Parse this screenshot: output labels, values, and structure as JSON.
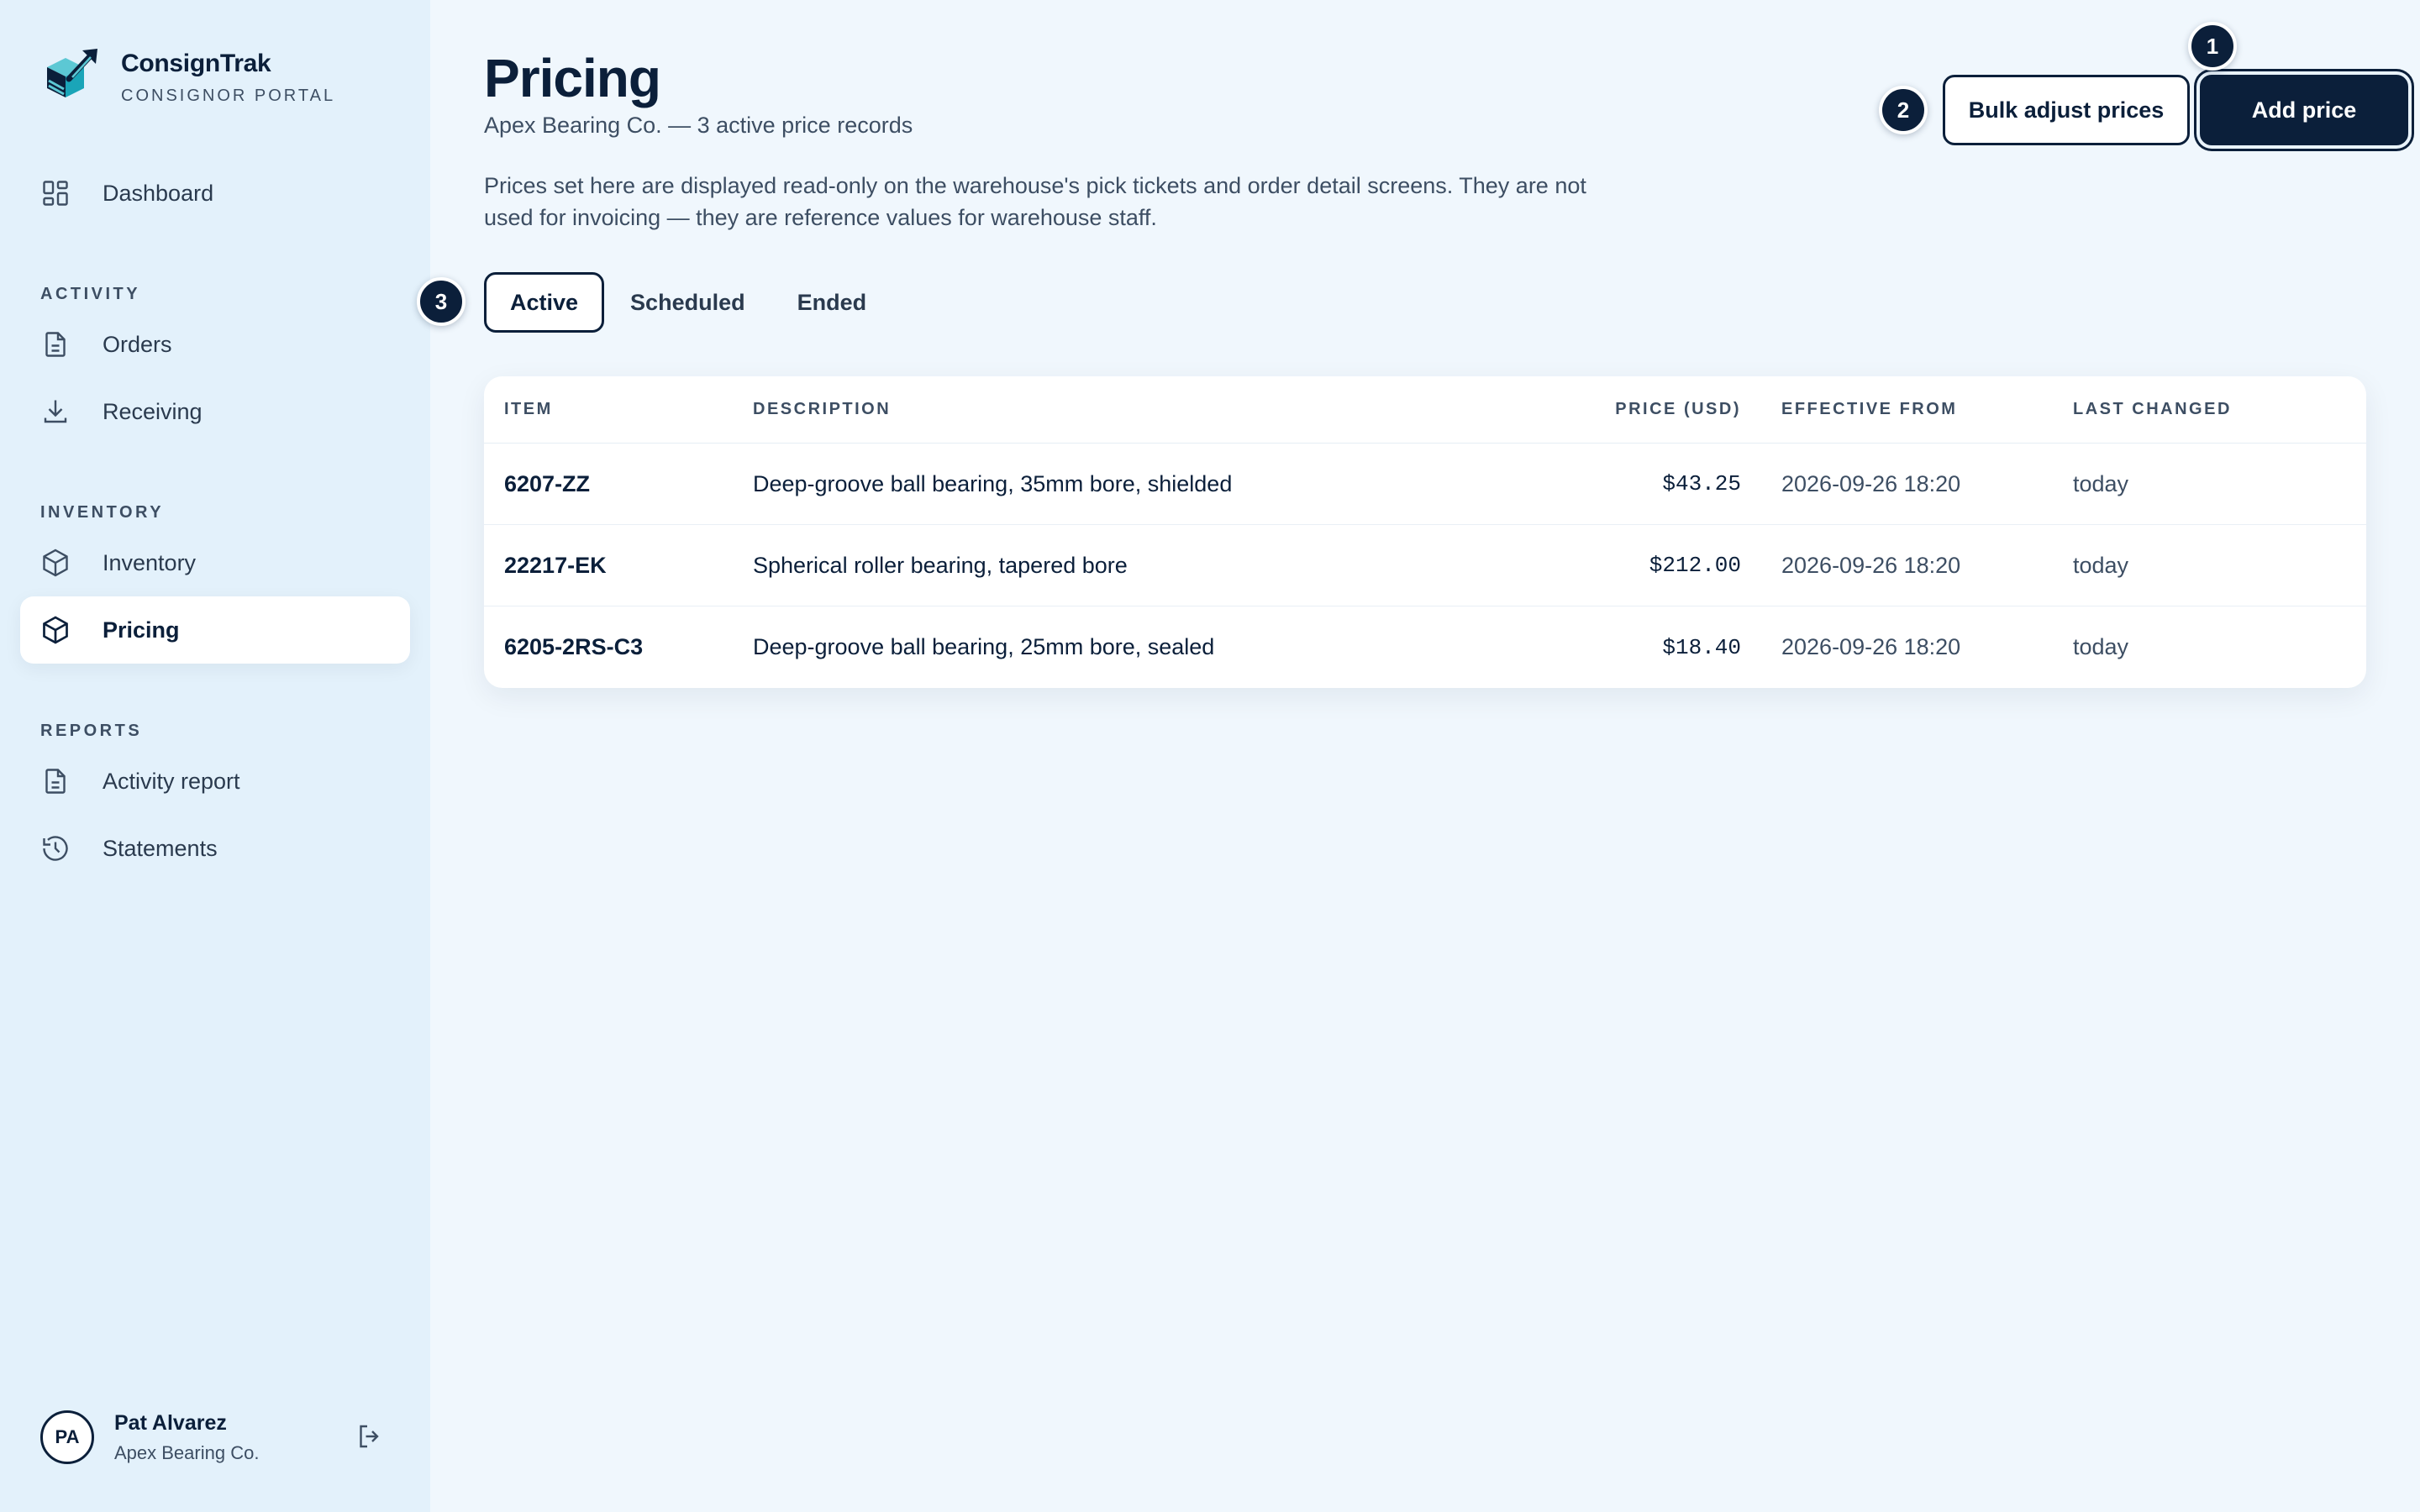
{
  "brand": {
    "name": "ConsignTrak",
    "subtitle": "CONSIGNOR PORTAL"
  },
  "sidebar": {
    "dashboard": "Dashboard",
    "sections": {
      "activity": "ACTIVITY",
      "inventory": "INVENTORY",
      "reports": "REPORTS"
    },
    "items": {
      "orders": "Orders",
      "receiving": "Receiving",
      "inventory": "Inventory",
      "pricing": "Pricing",
      "activity_report": "Activity report",
      "statements": "Statements"
    },
    "active_item": "pricing"
  },
  "user": {
    "initials": "PA",
    "name": "Pat Alvarez",
    "org": "Apex Bearing Co."
  },
  "page": {
    "title": "Pricing",
    "subtitle": "Apex Bearing Co. — 3 active price records",
    "description": "Prices set here are displayed read-only on the warehouse's pick tickets and order detail screens. They are not used for invoicing — they are reference values for warehouse staff."
  },
  "actions": {
    "bulk_adjust": "Bulk adjust prices",
    "add_price": "Add price"
  },
  "badges": {
    "one": "1",
    "two": "2",
    "three": "3"
  },
  "tabs": {
    "active": "Active",
    "scheduled": "Scheduled",
    "ended": "Ended",
    "selected": "active"
  },
  "table": {
    "columns": {
      "item": "ITEM",
      "description": "DESCRIPTION",
      "price": "PRICE (USD)",
      "effective": "EFFECTIVE FROM",
      "last_changed": "LAST CHANGED"
    },
    "rows": [
      {
        "item": "6207-ZZ",
        "description": "Deep-groove ball bearing, 35mm bore, shielded",
        "price": "$43.25",
        "effective": "2026-09-26 18:20",
        "last_changed": "today"
      },
      {
        "item": "22217-EK",
        "description": "Spherical roller bearing, tapered bore",
        "price": "$212.00",
        "effective": "2026-09-26 18:20",
        "last_changed": "today"
      },
      {
        "item": "6205-2RS-C3",
        "description": "Deep-groove ball bearing, 25mm bore, sealed",
        "price": "$18.40",
        "effective": "2026-09-26 18:20",
        "last_changed": "today"
      }
    ]
  },
  "colors": {
    "navy": "#0b1f3a",
    "sidebar_bg": "#e3f1fb",
    "page_bg": "#f0f7fd",
    "logo_teal": "#1aa5b8"
  }
}
